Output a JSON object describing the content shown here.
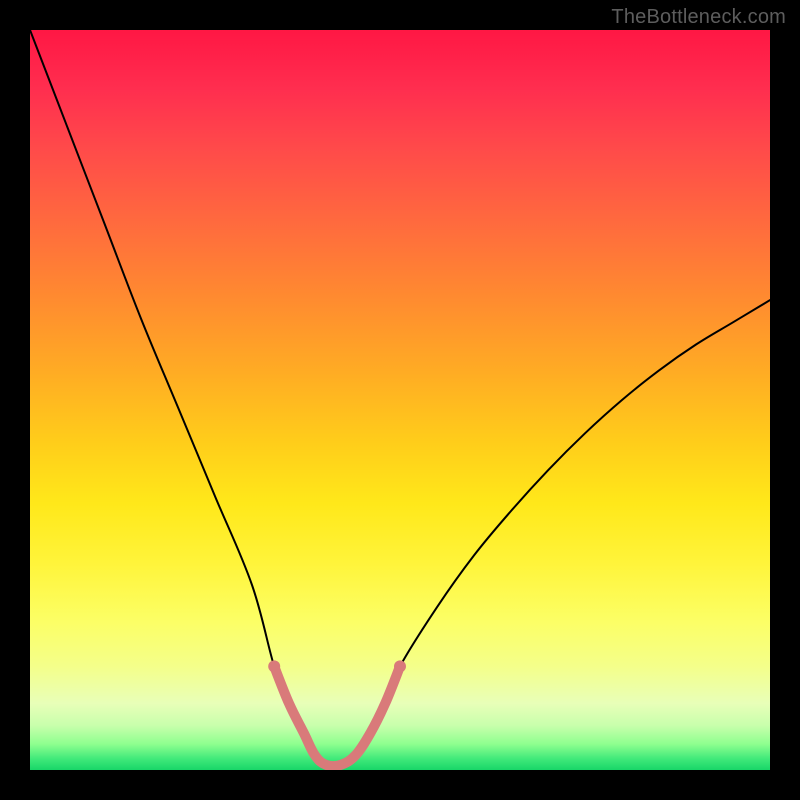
{
  "watermark": {
    "text": "TheBottleneck.com"
  },
  "chart_data": {
    "type": "line",
    "title": "",
    "xlabel": "",
    "ylabel": "",
    "xlim": [
      0,
      100
    ],
    "ylim": [
      0,
      100
    ],
    "grid": false,
    "series": [
      {
        "name": "bottleneck-curve",
        "color": "#000000",
        "stroke_width": 2,
        "x": [
          0,
          5,
          10,
          15,
          20,
          25,
          30,
          33,
          35,
          37,
          38.5,
          40,
          42,
          44,
          46,
          48,
          50,
          55,
          60,
          65,
          70,
          75,
          80,
          85,
          90,
          95,
          100
        ],
        "values": [
          100,
          87,
          74,
          61,
          49,
          37,
          25,
          14,
          9,
          5,
          2,
          0.5,
          0.5,
          2,
          5,
          9,
          14,
          22,
          29,
          35,
          40.5,
          45.5,
          50,
          54,
          57.5,
          60.5,
          63.5
        ]
      },
      {
        "name": "sweet-spot-band",
        "color": "#d97a7a",
        "stroke_width": 10,
        "x": [
          33,
          35,
          37,
          38.5,
          40,
          42,
          44,
          46,
          48,
          50
        ],
        "values": [
          14,
          9,
          5,
          2,
          0.7,
          0.7,
          2,
          5,
          9,
          14
        ]
      }
    ],
    "markers": {
      "name": "sweet-spot-endpoints",
      "color": "#d97a7a",
      "radius": 6,
      "points": [
        {
          "x": 33,
          "y": 14
        },
        {
          "x": 50,
          "y": 14
        }
      ]
    },
    "gradient_background": {
      "orientation": "vertical",
      "stops": [
        {
          "offset": 0.0,
          "color": "#ff1744"
        },
        {
          "offset": 0.5,
          "color": "#ffce1a"
        },
        {
          "offset": 0.8,
          "color": "#fcff66"
        },
        {
          "offset": 1.0,
          "color": "#18d668"
        }
      ]
    }
  }
}
